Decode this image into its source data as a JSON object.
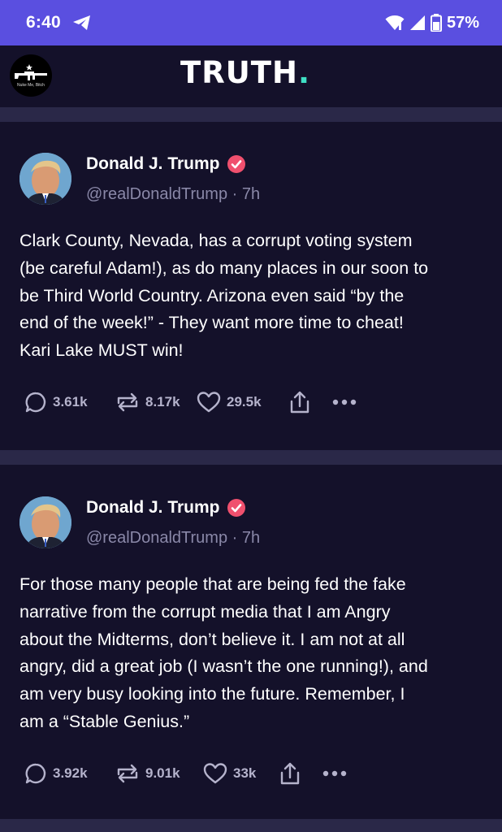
{
  "status_bar": {
    "time": "6:40",
    "battery": "57%",
    "icons": [
      "telegram-icon",
      "wifi-icon",
      "signal-icon",
      "battery-icon"
    ]
  },
  "header": {
    "logo_text": "TRUTH",
    "logo_dot": ".",
    "profile_avatar_caption": "Nuke Me, Bitch",
    "accent_color": "#3fe0c5"
  },
  "posts": [
    {
      "author": "Donald J. Trump",
      "handle": "@realDonaldTrump",
      "time": "· 7h",
      "verified": true,
      "text_lines": [
        "Clark County, Nevada, has a corrupt voting system",
        "(be careful Adam!), as do many places in our soon to",
        "be Third World Country. Arizona even said “by the",
        "end of the week!” - They want more time to cheat!",
        "Kari Lake MUST win!"
      ],
      "replies": "3.61k",
      "retruths": "8.17k",
      "likes": "29.5k"
    },
    {
      "author": "Donald J. Trump",
      "handle": "@realDonaldTrump",
      "time": "· 7h",
      "verified": true,
      "text_lines": [
        "For those many people that are being fed the fake",
        "narrative from the corrupt media that I am Angry",
        "about the Midterms, don’t believe it. I am not at all",
        "angry, did a great job (I wasn’t the one running!), and",
        "am very busy looking into the future. Remember, I",
        "am a “Stable Genius.”"
      ],
      "replies": "3.92k",
      "retruths": "9.01k",
      "likes": "33k"
    }
  ],
  "colors": {
    "status_bar": "#5a4fe0",
    "background": "#14112a",
    "divider": "#2a2848",
    "verified_badge": "#f0506e",
    "muted_text": "#8a88a8"
  }
}
